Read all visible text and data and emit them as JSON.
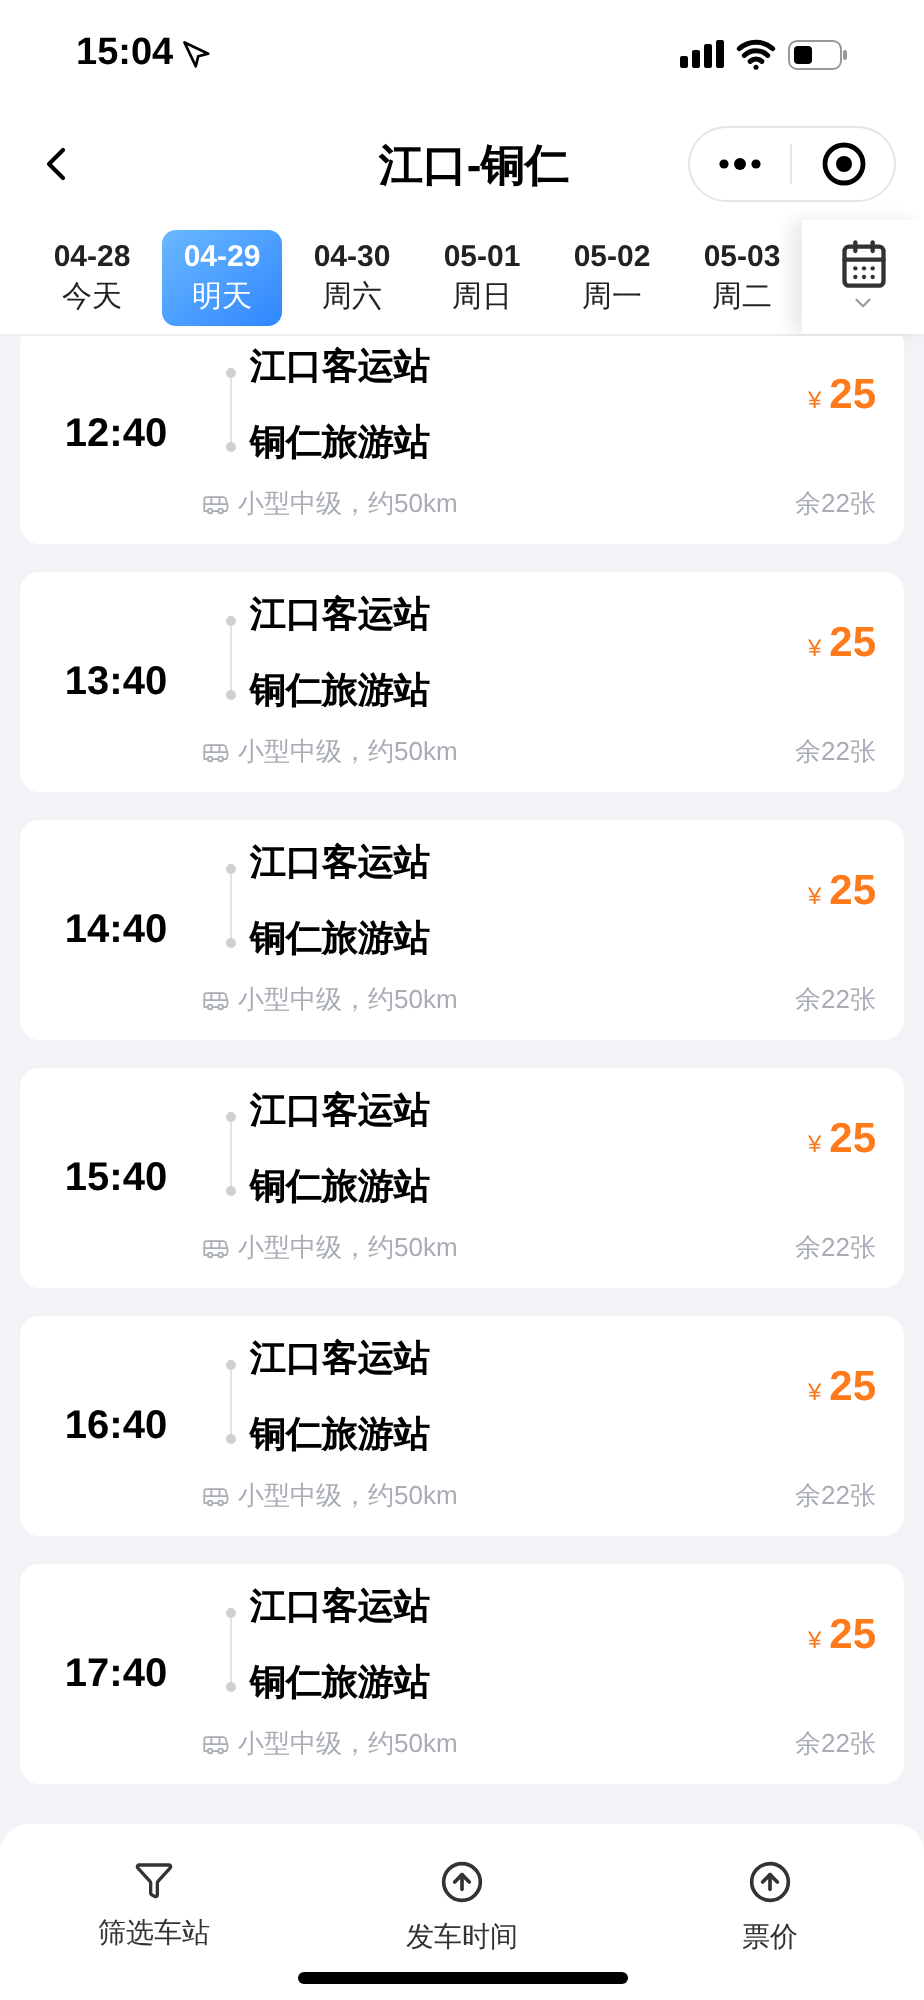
{
  "status_bar": {
    "time": "15:04"
  },
  "nav": {
    "title": "江口-铜仁"
  },
  "dates": [
    {
      "date": "04-28",
      "day": "今天",
      "selected": false
    },
    {
      "date": "04-29",
      "day": "明天",
      "selected": true
    },
    {
      "date": "04-30",
      "day": "周六",
      "selected": false
    },
    {
      "date": "05-01",
      "day": "周日",
      "selected": false
    },
    {
      "date": "05-02",
      "day": "周一",
      "selected": false
    },
    {
      "date": "05-03",
      "day": "周二",
      "selected": false
    }
  ],
  "trips": [
    {
      "time": "12:40",
      "from": "江口客运站",
      "to": "铜仁旅游站",
      "currency": "¥",
      "price": "25",
      "info": "小型中级，约50km",
      "remaining": "余22张"
    },
    {
      "time": "13:40",
      "from": "江口客运站",
      "to": "铜仁旅游站",
      "currency": "¥",
      "price": "25",
      "info": "小型中级，约50km",
      "remaining": "余22张"
    },
    {
      "time": "14:40",
      "from": "江口客运站",
      "to": "铜仁旅游站",
      "currency": "¥",
      "price": "25",
      "info": "小型中级，约50km",
      "remaining": "余22张"
    },
    {
      "time": "15:40",
      "from": "江口客运站",
      "to": "铜仁旅游站",
      "currency": "¥",
      "price": "25",
      "info": "小型中级，约50km",
      "remaining": "余22张"
    },
    {
      "time": "16:40",
      "from": "江口客运站",
      "to": "铜仁旅游站",
      "currency": "¥",
      "price": "25",
      "info": "小型中级，约50km",
      "remaining": "余22张"
    },
    {
      "time": "17:40",
      "from": "江口客运站",
      "to": "铜仁旅游站",
      "currency": "¥",
      "price": "25",
      "info": "小型中级，约50km",
      "remaining": "余22张"
    }
  ],
  "bottom_bar": [
    {
      "kind": "filter",
      "label": "筛选车站"
    },
    {
      "kind": "sort",
      "label": "发车时间"
    },
    {
      "kind": "sort",
      "label": "票价"
    }
  ]
}
